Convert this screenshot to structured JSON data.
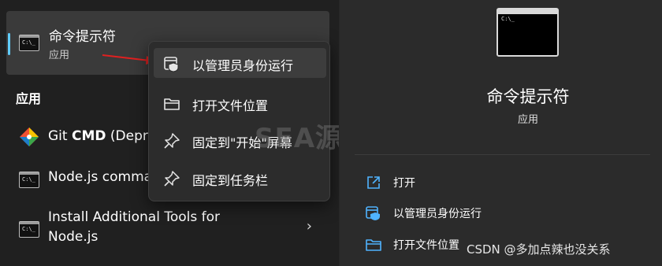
{
  "top_result": {
    "title": "命令提示符",
    "subtitle": "应用",
    "icon": "cmd-icon",
    "icon_glyph": "C:\\_"
  },
  "apps_section": {
    "heading": "应用",
    "items": [
      {
        "label_plain": "Git ",
        "label_bold": "CMD",
        "label_suffix": " (Depre",
        "icon": "git-icon"
      },
      {
        "label": "Node.js comma",
        "icon": "cmd-icon",
        "icon_glyph": "C:\\_"
      },
      {
        "label_line1": "Install Additional Tools for",
        "label_line2": "Node.js",
        "icon": "cmd-icon",
        "icon_glyph": "C:\\_",
        "chevron": "›"
      }
    ]
  },
  "context_menu": {
    "items": [
      {
        "label": "以管理员身份运行",
        "icon": "admin-shield-icon"
      },
      {
        "label": "打开文件位置",
        "icon": "folder-icon"
      },
      {
        "label": "固定到\"开始\"屏幕",
        "icon": "pin-icon"
      },
      {
        "label": "固定到任务栏",
        "icon": "pin-icon"
      }
    ]
  },
  "details_pane": {
    "title": "命令提示符",
    "subtitle": "应用",
    "icon_glyph": "C:\\_",
    "actions": [
      {
        "label": "打开",
        "icon": "open-external-icon"
      },
      {
        "label": "以管理员身份运行",
        "icon": "admin-shield-icon"
      },
      {
        "label": "打开文件位置",
        "icon": "folder-icon"
      }
    ]
  },
  "watermark": "SEA源码网",
  "csdn_watermark": "CSDN @多加点辣也没关系",
  "colors": {
    "accent": "#60cdff",
    "arrow": "#e02020",
    "menu_bg": "#2c2c2c",
    "action_icon": "#4fb3ff"
  }
}
